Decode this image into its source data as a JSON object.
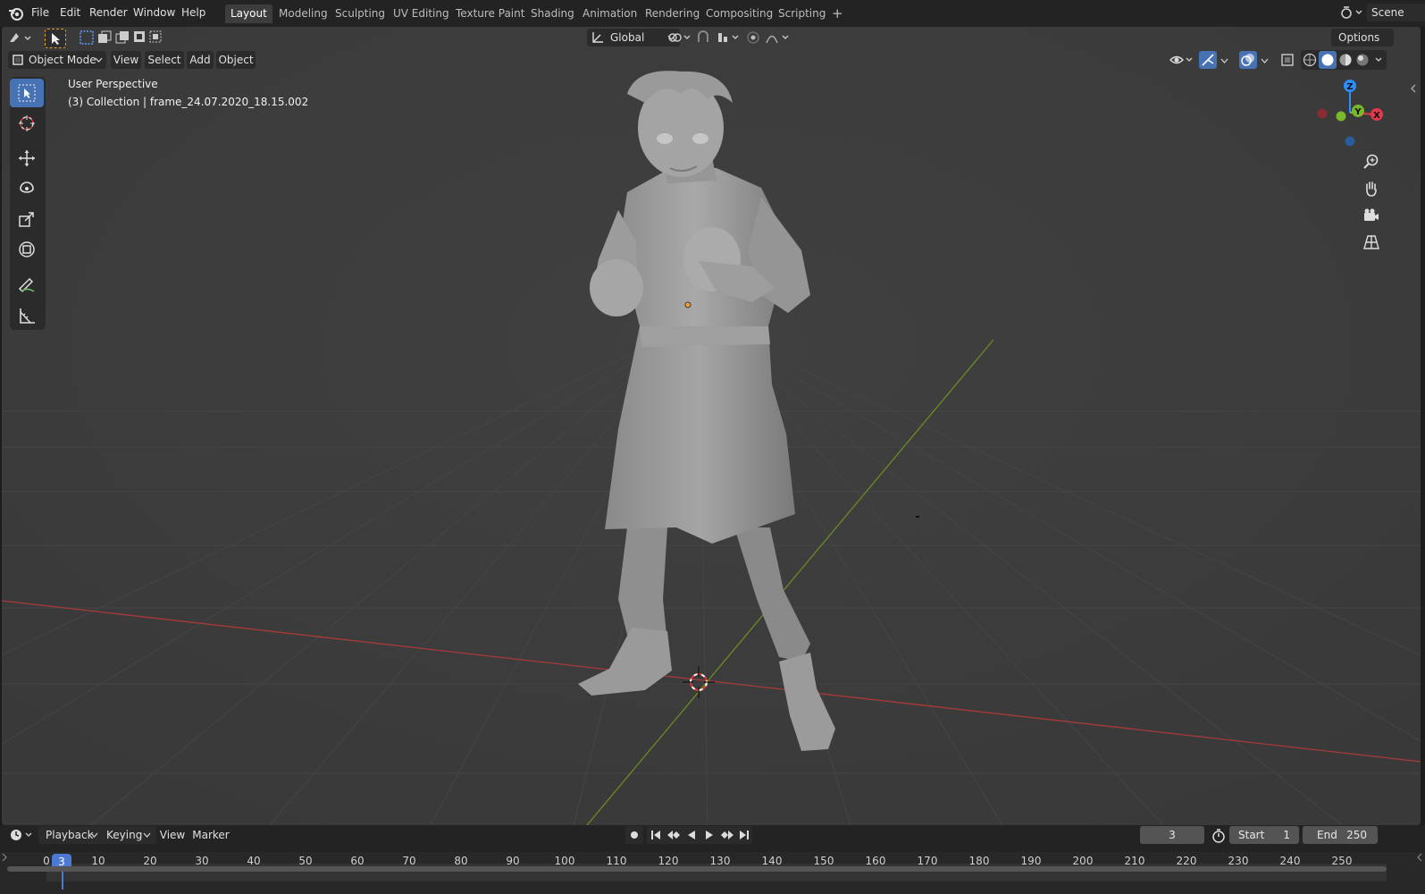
{
  "menubar": {
    "items": [
      "File",
      "Edit",
      "Render",
      "Window",
      "Help"
    ],
    "workspace_tabs": [
      "Layout",
      "Modeling",
      "Sculpting",
      "UV Editing",
      "Texture Paint",
      "Shading",
      "Animation",
      "Rendering",
      "Compositing",
      "Scripting"
    ],
    "active_tab": "Layout",
    "add_tab": "+",
    "scene_label": "Scene"
  },
  "tool_header": {
    "orientation": "Global",
    "options_label": "Options"
  },
  "viewport_header": {
    "mode": "Object Mode",
    "menus": [
      "View",
      "Select",
      "Add",
      "Object"
    ]
  },
  "overlay": {
    "view_name": "User Perspective",
    "collection_info": "(3) Collection | frame_24.07.2020_18.15.002"
  },
  "gizmo": {
    "x": "X",
    "y": "Y",
    "z": "Z",
    "x_color": "#e2384d",
    "y_color": "#7ab72b",
    "z_color": "#2c8fff"
  },
  "timeline": {
    "menus": [
      "Playback",
      "Keying",
      "View",
      "Marker"
    ],
    "current_frame": "3",
    "start_label": "Start",
    "start_value": "1",
    "end_label": "End",
    "end_value": "250",
    "ruler_numbers": [
      "0",
      "3",
      "10",
      "20",
      "30",
      "40",
      "50",
      "60",
      "70",
      "80",
      "90",
      "100",
      "110",
      "120",
      "130",
      "140",
      "150",
      "160",
      "170",
      "180",
      "190",
      "200",
      "210",
      "220",
      "230",
      "240",
      "250"
    ],
    "playhead_color": "#4a7ad3"
  },
  "colors": {
    "x_axis": "#a83a3a",
    "y_axis": "#6b8a22",
    "accent": "#4772b3"
  }
}
